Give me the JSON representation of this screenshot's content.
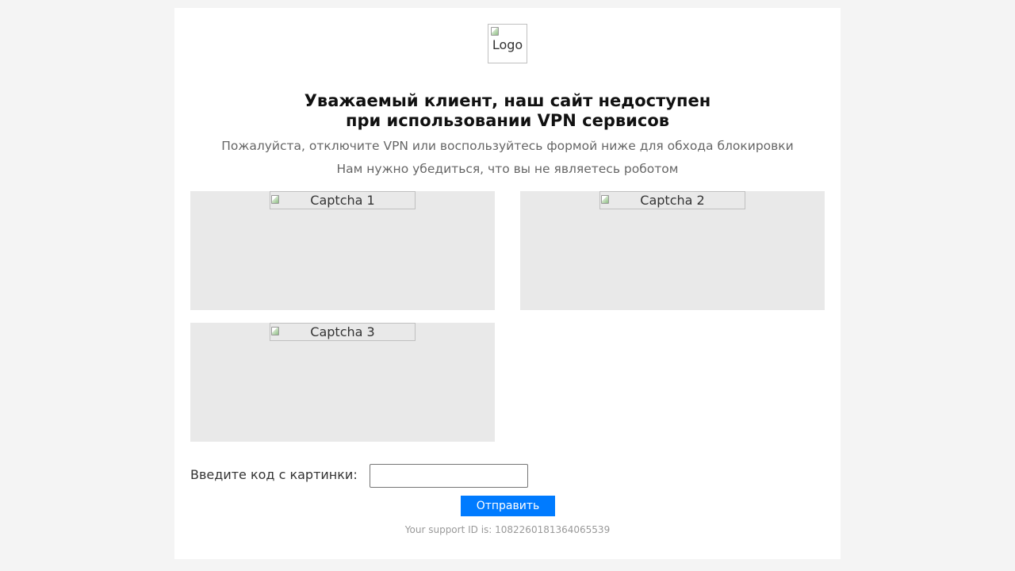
{
  "logo": {
    "alt_text": "Logo"
  },
  "headline": {
    "line1": "Уважаемый клиент, наш сайт недоступен",
    "line2": "при использовании VPN сервисов"
  },
  "subtext": {
    "disable_vpn": "Пожалуйста, отключите VPN или воспользуйтесь формой ниже для обхода блокировки",
    "robot_check": "Нам нужно убедиться, что вы не являетесь роботом"
  },
  "captchas": [
    {
      "alt_text": "Captcha 1"
    },
    {
      "alt_text": "Captcha 2"
    },
    {
      "alt_text": "Captcha 3"
    }
  ],
  "form": {
    "label": "Введите код с картинки:",
    "input_value": "",
    "submit_label": "Отправить"
  },
  "support": {
    "text": "Your support ID is: 10822601813640655​39"
  },
  "colors": {
    "background": "#f4f4f4",
    "card": "#ffffff",
    "captcha_bg": "#e9e9e9",
    "button": "#007bff",
    "button_text": "#ffffff",
    "muted_text": "#666666",
    "support_text": "#999999"
  }
}
